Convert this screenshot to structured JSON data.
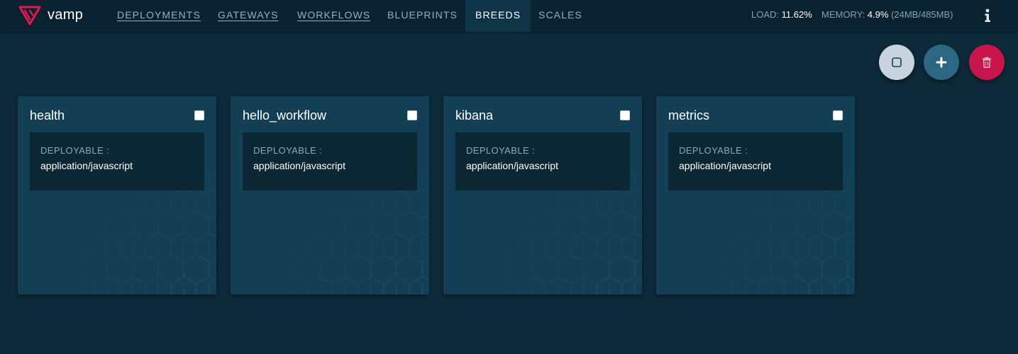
{
  "header": {
    "brand": "vamp",
    "nav": [
      {
        "label": "DEPLOYMENTS",
        "linked": true
      },
      {
        "label": "GATEWAYS",
        "linked": true
      },
      {
        "label": "WORKFLOWS",
        "linked": true
      },
      {
        "label": "BLUEPRINTS",
        "linked": false
      },
      {
        "label": "BREEDS",
        "linked": false,
        "active": true
      },
      {
        "label": "SCALES",
        "linked": false
      }
    ],
    "stats": {
      "load_label": "LOAD:",
      "load_value": "11.62%",
      "memory_label": "MEMORY:",
      "memory_value": "4.9%",
      "memory_detail": "(24MB/485MB)"
    },
    "info_icon": "info-icon"
  },
  "actions": {
    "select_all_icon": "square-icon",
    "add_icon": "plus-icon",
    "delete_icon": "trash-icon"
  },
  "breeds": [
    {
      "name": "health",
      "deployable_label": "DEPLOYABLE :",
      "deployable": "application/javascript"
    },
    {
      "name": "hello_workflow",
      "deployable_label": "DEPLOYABLE :",
      "deployable": "application/javascript"
    },
    {
      "name": "kibana",
      "deployable_label": "DEPLOYABLE :",
      "deployable": "application/javascript"
    },
    {
      "name": "metrics",
      "deployable_label": "DEPLOYABLE :",
      "deployable": "application/javascript"
    }
  ],
  "colors": {
    "background": "#0d2a3b",
    "topbar": "#0a2230",
    "card": "#133f55",
    "accent_red": "#c8154b",
    "accent_blue": "#2b6683",
    "link": "#8fb1c6"
  }
}
